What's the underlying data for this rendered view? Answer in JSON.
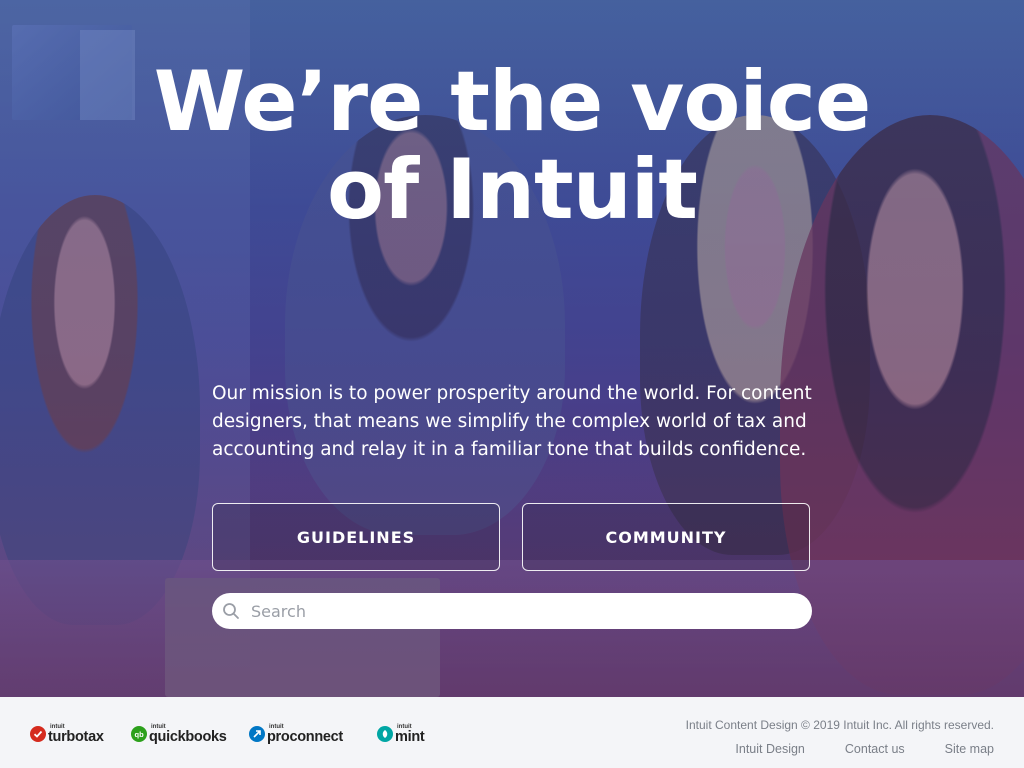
{
  "hero": {
    "headline_line1": "We’re the voice",
    "headline_line2": "of Intuit",
    "mission": "Our mission is to power prosperity around the world. For content designers, that means we simplify the complex world of tax and accounting and relay it in a familiar tone that builds confidence.",
    "buttons": [
      {
        "label": "GUIDELINES"
      },
      {
        "label": "COMMUNITY"
      }
    ],
    "search": {
      "placeholder": "Search",
      "value": ""
    }
  },
  "footer": {
    "brands": [
      {
        "prefix": "intuit",
        "name": "turbotax",
        "color": "#d52b1e",
        "icon": "checkmark-icon"
      },
      {
        "prefix": "intuit",
        "name": "quickbooks",
        "color": "#2ca01c",
        "icon": "qb-icon"
      },
      {
        "prefix": "intuit",
        "name": "proconnect",
        "color": "#0077c5",
        "icon": "proconnect-icon"
      },
      {
        "prefix": "intuit",
        "name": "mint",
        "color": "#00a6a4",
        "icon": "leaf-icon"
      }
    ],
    "copyright": "Intuit Content Design © 2019 Intuit Inc. All rights reserved.",
    "links": [
      {
        "label": "Intuit Design"
      },
      {
        "label": "Contact us"
      },
      {
        "label": "Site map"
      }
    ]
  },
  "colors": {
    "text_on_hero": "#ffffff",
    "footer_bg": "#f4f5f8",
    "footer_text": "#7a7f88"
  }
}
